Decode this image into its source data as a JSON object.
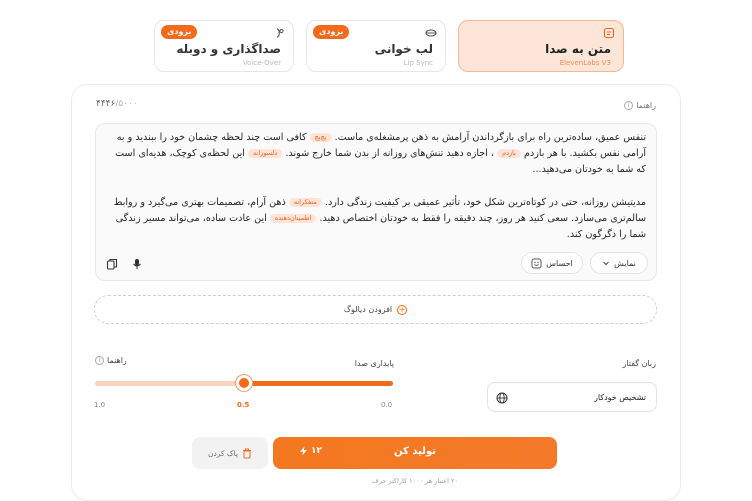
{
  "tabs": [
    {
      "label": "متن به صدا",
      "sub": "ElevenLabs V3",
      "badge": "",
      "active": true
    },
    {
      "label": "لب خوانی",
      "sub": "Lip Sync",
      "badge": "بزودی",
      "active": false
    },
    {
      "label": "صداگذاری و دوبله",
      "sub": "Voice-Over",
      "badge": "بزودی",
      "active": false
    }
  ],
  "editor": {
    "counter": "۴۴۴۶",
    "counter_max": "/۵۰۰۰",
    "guide_label": "راهنما",
    "p1_a": "تنفس عمیق، ساده‌ترین راه برای بازگرداندن آرامش به ذهن پرمشغله‌ی ماست.",
    "tag_whisper": "پچ‌پچ",
    "p1_b": "کافی است چند لحظه چشمان خود را ببندید و به آرامی نفس بکشید. با هر بازدم",
    "tag_exhale": "بازدم",
    "p1_c": "، اجازه دهید تنش‌های روزانه از بدن شما خارج شوند.",
    "tag_kind": "دلسوزانه",
    "p1_d": "این لحظه‌ی کوچک، هدیه‌ای است که شما به خودتان می‌دهید...",
    "p2_a": "مدیتیشن روزانه، حتی در کوتاه‌ترین شکل خود، تأثیر عمیقی بر کیفیت زندگی دارد.",
    "tag_thoughtful": "متفکرانه",
    "p2_b": "ذهن آرام، تصمیمات بهتری می‌گیرد و روابط سالم‌تری می‌سازد. سعی کنید هر روز، چند دقیقه را فقط به خودتان اختصاص دهید.",
    "tag_reassuring": "اطمینان‌دهنده",
    "p2_c": "این عادت ساده، می‌تواند مسیر زندگی شما را دگرگون کند.",
    "show_label": "نمایش",
    "emotion_label": "احساس"
  },
  "add_dialog_label": "افزودن دیالوگ",
  "settings": {
    "language_label": "زبان گفتار",
    "language_value": "تشخیص خودکار",
    "stability_label": "پایداری صدا",
    "guide_label": "راهنما",
    "slider_value": 0.5,
    "tick_left": "1.0",
    "tick_mid": "0.5",
    "tick_right": "0.0"
  },
  "actions": {
    "generate_label": "تولید کن",
    "cost": "۱۲",
    "clear_label": "پاک کردن",
    "note": "۲۰ اعتبار هر ۱۰۰۰ کاراکتر حرف"
  },
  "colors": {
    "accent": "#f26b1d",
    "accent_soft": "#fde6d8"
  }
}
